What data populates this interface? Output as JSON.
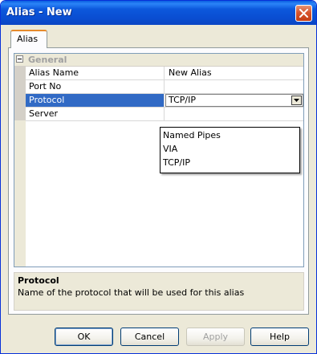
{
  "window": {
    "title": "Alias - New"
  },
  "tabs": [
    {
      "label": "Alias"
    }
  ],
  "properties": {
    "category": "General",
    "rows": [
      {
        "name": "Alias Name",
        "value": "New Alias"
      },
      {
        "name": "Port No",
        "value": ""
      },
      {
        "name": "Protocol",
        "value": "TCP/IP"
      },
      {
        "name": "Server",
        "value": ""
      }
    ]
  },
  "protocol_dropdown": {
    "selected": "TCP/IP",
    "options": [
      "Named Pipes",
      "VIA",
      "TCP/IP"
    ]
  },
  "description": {
    "title": "Protocol",
    "text": "Name of the protocol that will be used for this alias"
  },
  "buttons": {
    "ok": "OK",
    "cancel": "Cancel",
    "apply": "Apply",
    "help": "Help"
  },
  "colors": {
    "titlebar": "#0a4ed2",
    "selection": "#316ac5",
    "close": "#c43d14"
  }
}
